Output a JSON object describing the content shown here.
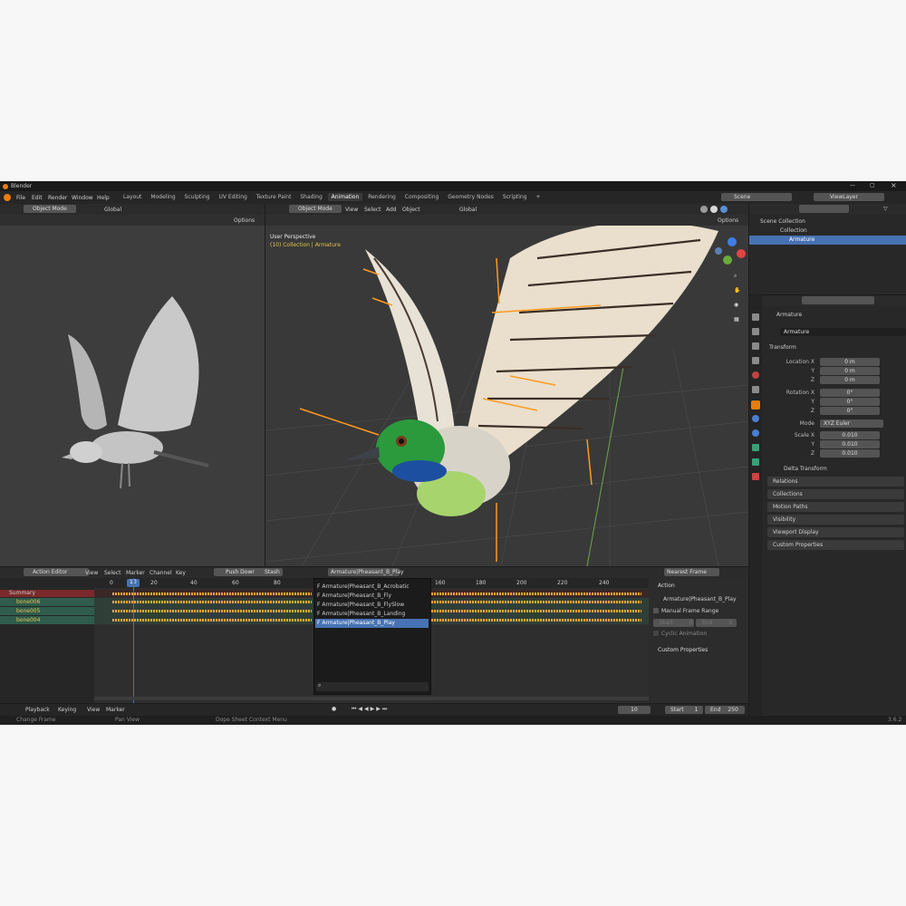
{
  "app": {
    "title": "Blender",
    "version": "3.6.2"
  },
  "menu": [
    "File",
    "Edit",
    "Render",
    "Window",
    "Help"
  ],
  "workspaces": [
    "Layout",
    "Modeling",
    "Sculpting",
    "UV Editing",
    "Texture Paint",
    "Shading",
    "Animation",
    "Rendering",
    "Compositing",
    "Geometry Nodes",
    "Scripting",
    "+"
  ],
  "active_workspace": "Animation",
  "scene": {
    "label": "Scene",
    "view_layer": "ViewLayer"
  },
  "left_viewport": {
    "mode": "Object Mode",
    "orientation": "Global",
    "options": "Options"
  },
  "main_viewport": {
    "mode": "Object Mode",
    "menus": [
      "View",
      "Select",
      "Add",
      "Object"
    ],
    "orientation": "Global",
    "options": "Options",
    "overlay_title": "User Perspective",
    "overlay_sub": "(10) Collection | Armature"
  },
  "outliner": {
    "root": "Scene Collection",
    "items": [
      {
        "label": "Collection"
      },
      {
        "label": "Armature"
      }
    ]
  },
  "properties": {
    "object_name": "Armature",
    "data_name": "Armature",
    "transform": "Transform",
    "location": [
      {
        "axis": "Location X",
        "value": "0 m"
      },
      {
        "axis": "Y",
        "value": "0 m"
      },
      {
        "axis": "Z",
        "value": "0 m"
      }
    ],
    "rotation": [
      {
        "axis": "Rotation X",
        "value": "0°"
      },
      {
        "axis": "Y",
        "value": "0°"
      },
      {
        "axis": "Z",
        "value": "0°"
      }
    ],
    "mode_label": "Mode",
    "mode_value": "XYZ Euler",
    "scale": [
      {
        "axis": "Scale X",
        "value": "0.010"
      },
      {
        "axis": "Y",
        "value": "0.010"
      },
      {
        "axis": "Z",
        "value": "0.010"
      }
    ],
    "delta": "Delta Transform",
    "sections": [
      "Relations",
      "Collections",
      "Motion Paths",
      "Visibility",
      "Viewport Display",
      "Custom Properties"
    ]
  },
  "dopesheet": {
    "editor": "Action Editor",
    "menus": [
      "View",
      "Select",
      "Marker",
      "Channel",
      "Key"
    ],
    "push_down": "Push Down",
    "stash": "Stash",
    "action": "Armature|Pheasant_B_Play",
    "snap": "Nearest Frame",
    "ruler": [
      "0",
      "10",
      "20",
      "40",
      "60",
      "80",
      "160",
      "180",
      "200",
      "220",
      "240"
    ],
    "current_frame": "10",
    "channels": [
      {
        "label": "Summary"
      },
      {
        "label": "bone006"
      },
      {
        "label": "bone005"
      },
      {
        "label": "bone004"
      }
    ],
    "action_list": [
      "F Armature|Pheasant_B_Acrobatic",
      "F Armature|Pheasant_B_Fly",
      "F Armature|Pheasant_B_FlySlow",
      "F Armature|Pheasant_B_Landing",
      "F Armature|Pheasant_B_Play"
    ],
    "sidebar": {
      "title": "Action",
      "action_name": "Armature|Pheasant_B_Play",
      "manual_range": "Manual Frame Range",
      "start_label": "Start",
      "start_val": "0",
      "end_label": "End",
      "end_val": "0",
      "cyclic": "Cyclic Animation",
      "custom": "Custom Properties"
    }
  },
  "timeline": {
    "menus": [
      "Playback",
      "Keying",
      "View",
      "Marker"
    ],
    "frame": "10",
    "start_label": "Start",
    "start": "1",
    "end_label": "End",
    "end": "250"
  },
  "statusbar": {
    "change_frame": "Change Frame",
    "pan_view": "Pan View",
    "context_menu": "Dope Sheet Context Menu"
  }
}
